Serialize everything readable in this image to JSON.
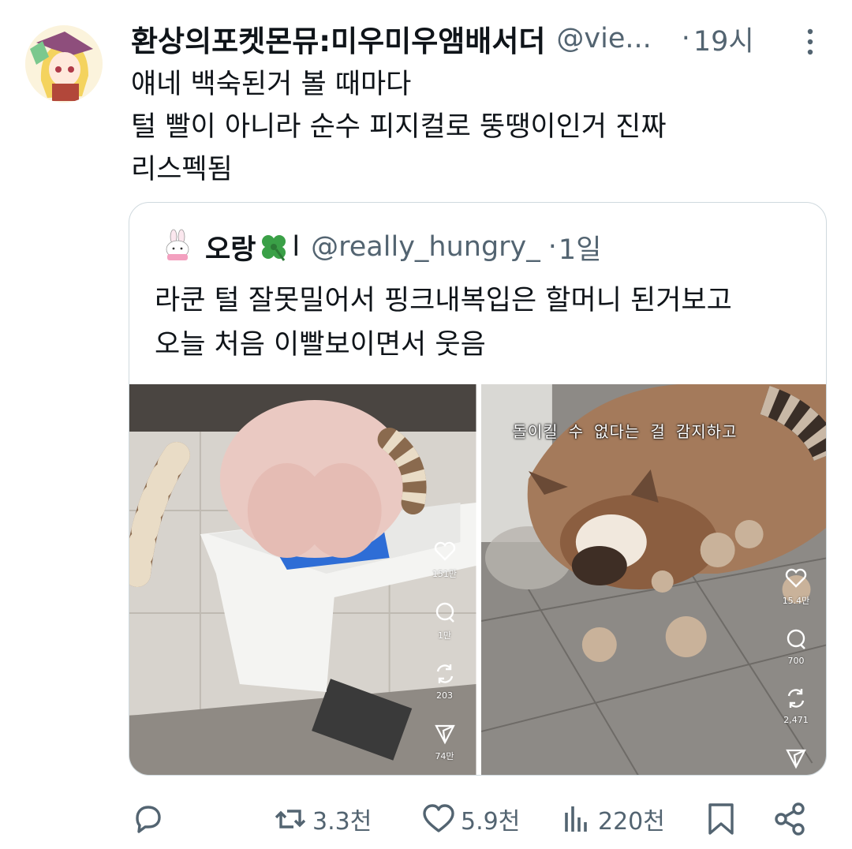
{
  "tweet": {
    "display_name": "환상의포켓몬뮤:미우미우앰배서더",
    "handle": "@vie...",
    "separator": "·",
    "time": "19시",
    "text_lines": [
      "얘네 백숙된거 볼 때마다",
      "털 빨이 아니라 순수 피지컬로 뚱땡이인거 진짜",
      "리스펙됨"
    ]
  },
  "quote": {
    "display_name": "오랑",
    "bar": "l",
    "handle": "@really_hungry_",
    "separator": "·",
    "time": "1일",
    "text_lines": [
      "라쿤 털 잘못밀어서 핑크내복입은 할머니 된거보고",
      "오늘 처음 이빨보이면서 웃음"
    ],
    "media": [
      {
        "stats": {
          "likes": "151만",
          "comments": "1만",
          "reposts": "203",
          "shares": "74만"
        }
      },
      {
        "caption": "돌이킬 수 없다는 걸 감지하고",
        "stats": {
          "likes": "15.4만",
          "comments": "700",
          "reposts": "2,471"
        }
      }
    ]
  },
  "actions": {
    "reply_icon": "reply-icon",
    "retweet_count": "3.3천",
    "like_count": "5.9천",
    "view_count": "220천",
    "bookmark_icon": "bookmark-icon",
    "share_icon": "share-icon"
  },
  "colors": {
    "text": "#0f1419",
    "secondary": "#536471",
    "border": "#cfd9de"
  }
}
